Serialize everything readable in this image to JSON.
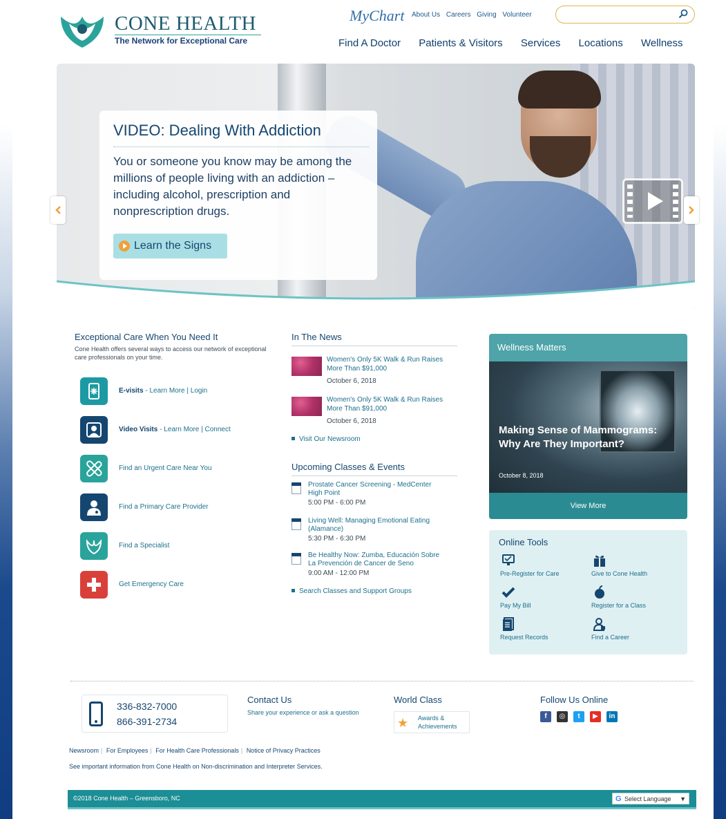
{
  "header": {
    "logo_name": "CONE HEALTH",
    "logo_tagline": "The Network for Exceptional Care",
    "mychart": "MyChart",
    "util_links": [
      "About Us",
      "Careers",
      "Giving",
      "Volunteer"
    ],
    "search_placeholder": "",
    "nav": [
      "Find A Doctor",
      "Patients & Visitors",
      "Services",
      "Locations",
      "Wellness"
    ]
  },
  "hero": {
    "title": "VIDEO: Dealing With Addiction",
    "text": "You or someone you know may be among the millions of people living with an addiction – including alcohol, prescription and nonprescription drugs.",
    "button": "Learn the Signs"
  },
  "care": {
    "title": "Exceptional Care When You Need It",
    "intro": "Cone Health offers several ways to access our network of exceptional care professionals on your time.",
    "items": [
      {
        "strong": "E-visits",
        "rest": " - Learn More | Login",
        "color": "#1c9aa3"
      },
      {
        "strong": "Video Visits",
        "rest": " - Learn More | Connect",
        "color": "#15466f"
      },
      {
        "strong": "",
        "rest": "Find an Urgent Care Near You",
        "color": "#2aa39b"
      },
      {
        "strong": "",
        "rest": "Find a Primary Care Provider",
        "color": "#15466f"
      },
      {
        "strong": "",
        "rest": "Find a Specialist",
        "color": "#2aa39b"
      },
      {
        "strong": "",
        "rest": "Get Emergency Care",
        "color": "#d9403a"
      }
    ]
  },
  "news": {
    "title": "In The News",
    "items": [
      {
        "title": "Women's Only 5K Walk & Run Raises More Than $91,000",
        "date": "October 6, 2018"
      },
      {
        "title": "Women's Only 5K Walk & Run Raises More Than $91,000",
        "date": "October 6, 2018"
      }
    ],
    "newsroom_link": "Visit Our Newsroom"
  },
  "events": {
    "title": "Upcoming Classes & Events",
    "items": [
      {
        "title": "Prostate Cancer Screening - MedCenter High Point",
        "time": "5:00 PM - 6:00 PM"
      },
      {
        "title": "Living Well: Managing Emotional Eating (Alamance)",
        "time": "5:30 PM - 6:30 PM"
      },
      {
        "title": "Be Healthy Now: Zumba, Educación Sobre La Prevención de Cancer de Seno",
        "time": "9:00 AM - 12:00 PM"
      }
    ],
    "search_link": "Search Classes and Support Groups"
  },
  "wellness": {
    "title": "Wellness Matters",
    "headline": "Making Sense of Mammograms: Why Are They Important?",
    "date": "October 8, 2018",
    "more": "View More"
  },
  "tools": {
    "title": "Online Tools",
    "items": [
      "Pre-Register for Care",
      "Give to Cone Health",
      "Pay My Bill",
      "Register for a Class",
      "Request Records",
      "Find a Career"
    ]
  },
  "footer": {
    "phone1": "336-832-7000",
    "phone2": "866-391-2734",
    "contact_title": "Contact Us",
    "contact_text": "Share your experience or ask a question",
    "world_title": "World Class",
    "award_text": "Awards & Achievements",
    "follow_title": "Follow Us Online",
    "social": [
      {
        "name": "facebook",
        "glyph": "f",
        "color": "#3b5998"
      },
      {
        "name": "instagram",
        "glyph": "◎",
        "color": "#333333"
      },
      {
        "name": "twitter",
        "glyph": "t",
        "color": "#1da1f2"
      },
      {
        "name": "youtube",
        "glyph": "▶",
        "color": "#e52d27"
      },
      {
        "name": "linkedin",
        "glyph": "in",
        "color": "#0077b5"
      }
    ],
    "links": [
      "Newsroom",
      "For Employees",
      "For Health Care Professionals",
      "Notice of Privacy Practices"
    ],
    "note": "See important information from Cone Health on Non-discrimination and Interpreter Services.",
    "copyright": "©2018 Cone Health – Greensboro, NC",
    "language": "Select Language",
    "language_g": "G",
    "language_dd": "▼"
  }
}
